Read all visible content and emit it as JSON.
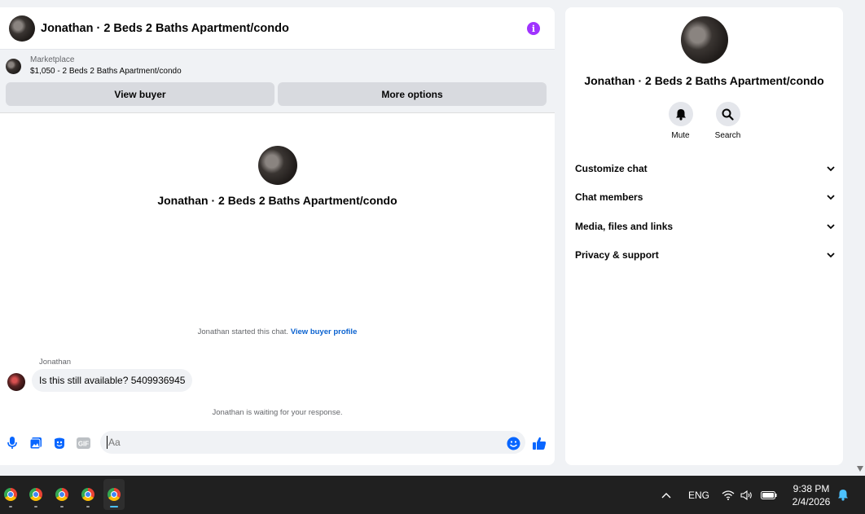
{
  "chat": {
    "title": "Jonathan · 2 Beds 2 Baths Apartment/condo",
    "marketplace_label": "Marketplace",
    "listing": "$1,050 - 2 Beds 2 Baths Apartment/condo",
    "view_buyer_label": "View buyer",
    "more_options_label": "More options",
    "center_name": "Jonathan · 2 Beds 2 Baths Apartment/condo",
    "started_text": "Jonathan started this chat.",
    "buyer_profile_link": "View buyer profile",
    "sender_name": "Jonathan",
    "message": "Is this still available? 5409936945",
    "waiting_text": "Jonathan is waiting for your response.",
    "composer_placeholder": "Aa"
  },
  "side": {
    "name": "Jonathan · 2 Beds 2 Baths Apartment/condo",
    "actions": [
      {
        "label": "Mute",
        "icon": "bell-icon"
      },
      {
        "label": "Search",
        "icon": "search-icon"
      }
    ],
    "sections": [
      {
        "label": "Customize chat"
      },
      {
        "label": "Chat members"
      },
      {
        "label": "Media, files and links"
      },
      {
        "label": "Privacy & support"
      }
    ]
  },
  "taskbar": {
    "apps": [
      "chrome-icon",
      "chrome-icon",
      "chrome-icon",
      "chrome-icon",
      "chrome-icon"
    ],
    "language": "ENG",
    "time": "9:38 PM",
    "date": "2/4/2026"
  },
  "colors": {
    "accent": "#0866ff",
    "info": "#a033ff",
    "link": "#0a62d0"
  }
}
